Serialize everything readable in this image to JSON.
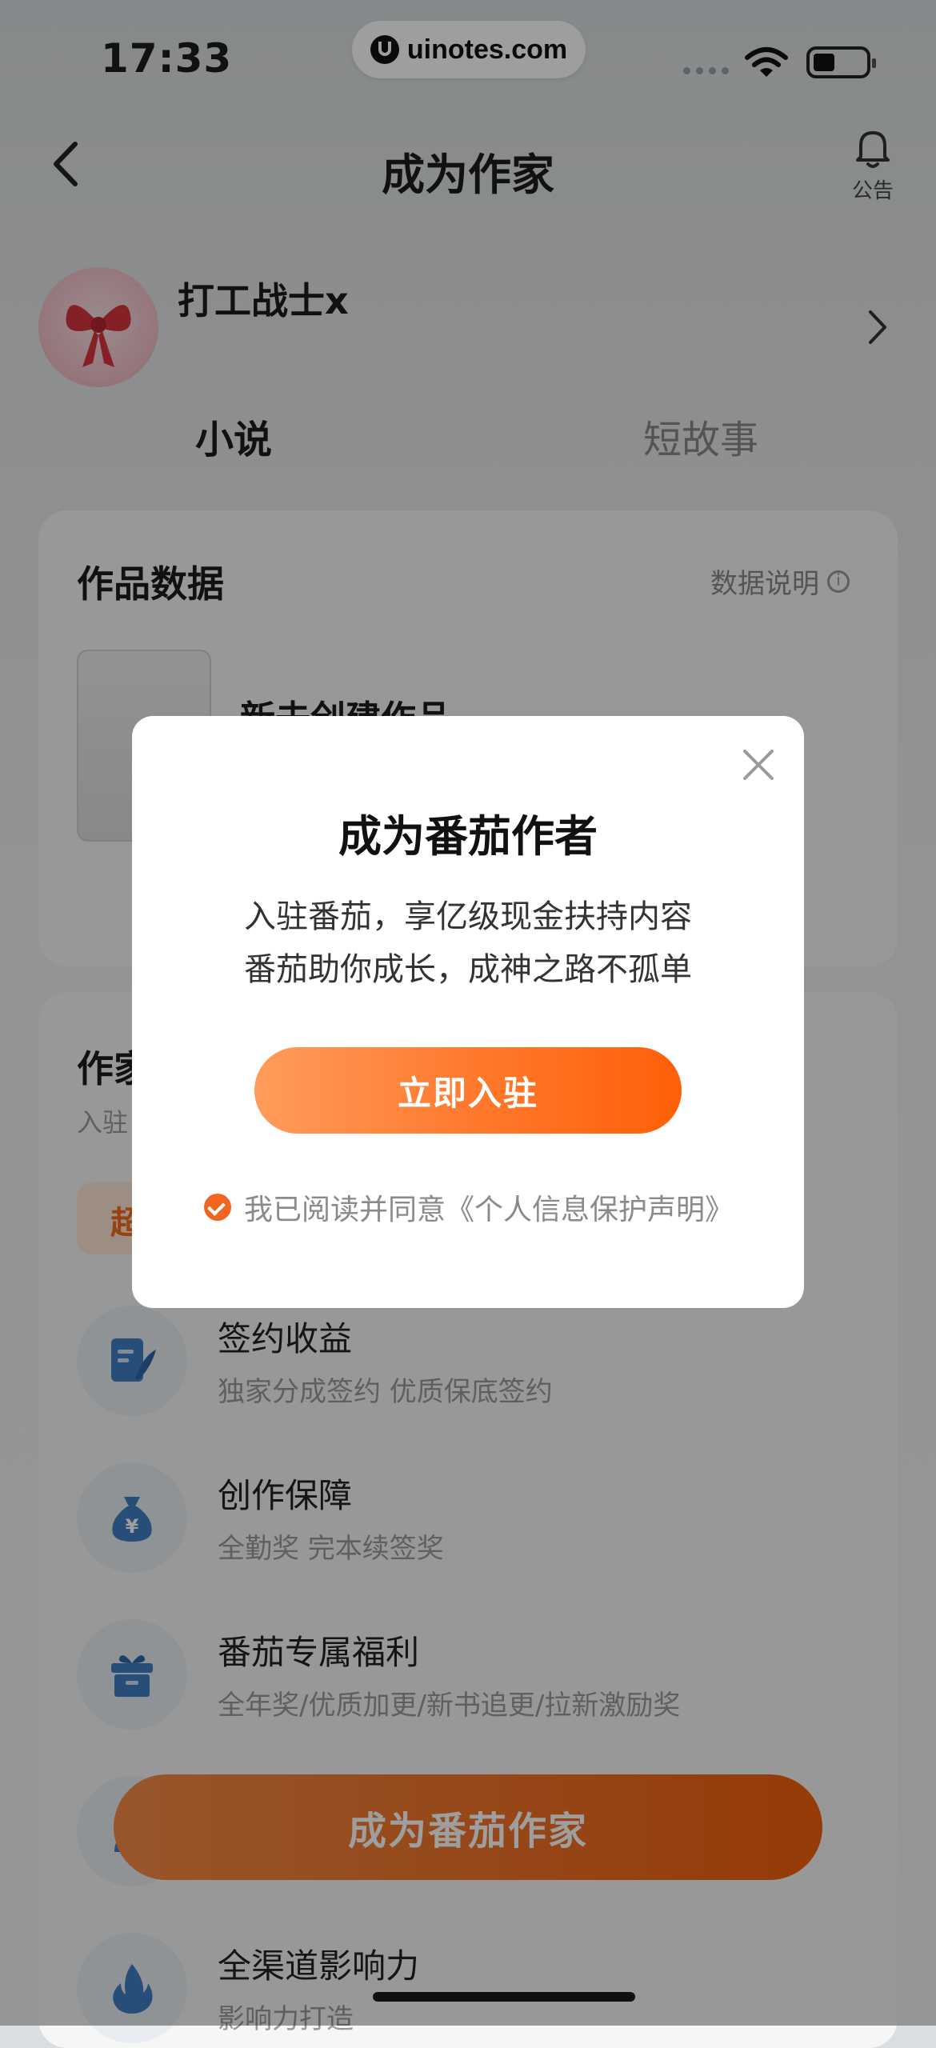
{
  "status_bar": {
    "time": "17:33",
    "watermark": "uinotes.com"
  },
  "nav": {
    "title": "成为作家",
    "notice_label": "公告"
  },
  "profile": {
    "username": "打工战士x"
  },
  "tabs": [
    "小说",
    "短故事"
  ],
  "works_card": {
    "title": "作品数据",
    "explain_label": "数据说明",
    "new_work_label": "新去创建作品"
  },
  "author_section": {
    "title_partial": "作家",
    "subtitle_partial": "入驻",
    "chip_partial": "超"
  },
  "benefits": [
    {
      "icon": "contract-icon",
      "title": "签约收益",
      "desc": "独家分成签约 优质保底签约"
    },
    {
      "icon": "money-bag-icon",
      "title": "创作保障",
      "desc": "全勤奖 完本续签奖"
    },
    {
      "icon": "gift-icon",
      "title": "番茄专属福利",
      "desc": "全年奖/优质加更/新书追更/拉新激励奖"
    },
    {
      "icon": "flame-icon",
      "title": "全渠道影响力",
      "desc": "影响力打造"
    }
  ],
  "bottom_cta": "成为番茄作家",
  "modal": {
    "title": "成为番茄作者",
    "line1": "入驻番茄，享亿级现金扶持内容",
    "line2": "番茄助你成长，成神之路不孤单",
    "button": "立即入驻",
    "agreement": "我已阅读并同意《个人信息保护声明》"
  },
  "colors": {
    "accent": "#ff6a14",
    "overlay": "rgba(0,0,0,0.38)"
  }
}
